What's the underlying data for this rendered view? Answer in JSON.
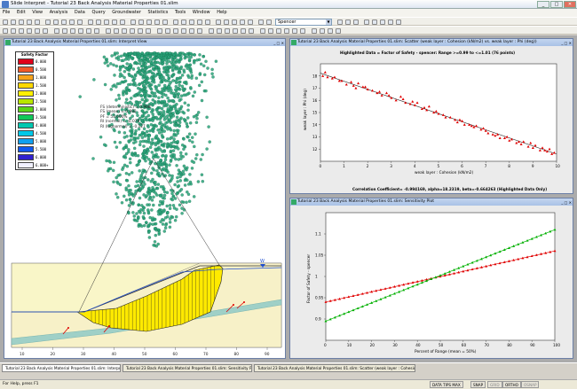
{
  "app_title": "Slide Interpret - Tutorial 23 Back Analysis Material Properties 01.slim",
  "window_controls": {
    "min": "_",
    "max": "□",
    "close": "✕"
  },
  "menu": [
    "File",
    "Edit",
    "View",
    "Analysis",
    "Data",
    "Query",
    "Groundwater",
    "Statistics",
    "Tools",
    "Window",
    "Help"
  ],
  "method_combo": "Spencer",
  "windows": {
    "interpret": {
      "title": "Tutorial 23 Back Analysis Material Properties 01.slim: Interpret View",
      "legend_title": "Safety Factor",
      "legend": [
        {
          "value": "0.000",
          "color": "#e0001a"
        },
        {
          "value": "0.500",
          "color": "#f05828"
        },
        {
          "value": "1.000",
          "color": "#f6a21a"
        },
        {
          "value": "1.500",
          "color": "#ffd800"
        },
        {
          "value": "2.000",
          "color": "#fff000"
        },
        {
          "value": "2.500",
          "color": "#b8e600"
        },
        {
          "value": "3.000",
          "color": "#5ad418"
        },
        {
          "value": "3.500",
          "color": "#10c85a"
        },
        {
          "value": "4.000",
          "color": "#00c8b0"
        },
        {
          "value": "4.500",
          "color": "#00c8e8"
        },
        {
          "value": "5.000",
          "color": "#10a0f0"
        },
        {
          "value": "5.500",
          "color": "#1058f0"
        },
        {
          "value": "6.000",
          "color": "#3020d0"
        },
        {
          "value": "6.000+",
          "color": "#f0f0ff"
        }
      ],
      "annotation": [
        "FS (deterministic) = 0.998",
        "FS (mean) = 0.992",
        "PF = 53.600%",
        "RI (normal) = -0.079",
        "RI (lognormal) = -0.127"
      ],
      "water_marker": "W",
      "x_ticks": [
        "10",
        "20",
        "30",
        "40",
        "50",
        "60",
        "70",
        "80",
        "90"
      ]
    },
    "scatter": {
      "title": "Tutorial 23 Back Analysis Material Properties 01.slim: Scatter (weak layer : Cohesion (kN/m2) vs. weak layer : Phi (deg))",
      "chart_title": "Highlighted Data = Factor of Safety - spencer: Range >=0.99 to <=1.01   (76 points)",
      "footer": "Correlation Coefficient= -0.994169, alpha=18.2319, beta=-0.664263 (Highlighted Data Only)",
      "xlabel": "weak layer : Cohesion (kN/m2)",
      "ylabel": "weak layer : Phi (deg)"
    },
    "sensitivity": {
      "title": "Tutorial 23 Back Analysis Material Properties 01.slim: Sensitivity Plot",
      "xlabel": "Percent of Range (mean = 50%)",
      "ylabel": "Factor of Safety - spencer"
    }
  },
  "chart_data": [
    {
      "type": "scatter",
      "title": "Highlighted Data = Factor of Safety - spencer: Range >=0.99 to <=1.01   (76 points)",
      "xlabel": "weak layer : Cohesion (kN/m2)",
      "ylabel": "weak layer : Phi (deg)",
      "xlim": [
        0,
        10
      ],
      "ylim": [
        11,
        19
      ],
      "x_ticks": [
        0,
        1,
        2,
        3,
        4,
        5,
        6,
        7,
        8,
        9,
        10
      ],
      "y_ticks": [
        12,
        13,
        14,
        15,
        16,
        17,
        18
      ],
      "fit_line": {
        "x": [
          0,
          10
        ],
        "y": [
          18.23,
          11.59
        ]
      },
      "points": [
        [
          0.1,
          18.0
        ],
        [
          0.3,
          17.9
        ],
        [
          0.5,
          17.8
        ],
        [
          0.2,
          18.3
        ],
        [
          0.9,
          17.6
        ],
        [
          1.1,
          17.3
        ],
        [
          1.3,
          17.5
        ],
        [
          1.5,
          17.0
        ],
        [
          1.6,
          17.4
        ],
        [
          1.8,
          17.1
        ],
        [
          2.0,
          16.9
        ],
        [
          2.2,
          16.8
        ],
        [
          2.4,
          16.6
        ],
        [
          2.6,
          16.4
        ],
        [
          2.8,
          16.6
        ],
        [
          3.0,
          16.2
        ],
        [
          3.2,
          16.0
        ],
        [
          3.4,
          16.3
        ],
        [
          3.6,
          15.8
        ],
        [
          3.8,
          15.7
        ],
        [
          4.0,
          15.6
        ],
        [
          4.1,
          15.8
        ],
        [
          4.3,
          15.3
        ],
        [
          4.5,
          15.2
        ],
        [
          4.6,
          15.5
        ],
        [
          4.8,
          15.0
        ],
        [
          5.0,
          14.9
        ],
        [
          5.2,
          14.8
        ],
        [
          5.3,
          14.6
        ],
        [
          5.5,
          14.6
        ],
        [
          5.7,
          14.4
        ],
        [
          5.8,
          14.2
        ],
        [
          6.0,
          14.3
        ],
        [
          6.1,
          14.0
        ],
        [
          6.3,
          14.0
        ],
        [
          6.5,
          13.8
        ],
        [
          6.6,
          13.9
        ],
        [
          6.8,
          13.6
        ],
        [
          7.0,
          13.5
        ],
        [
          7.1,
          13.3
        ],
        [
          7.3,
          13.2
        ],
        [
          7.5,
          13.2
        ],
        [
          7.6,
          12.9
        ],
        [
          7.8,
          12.9
        ],
        [
          8.0,
          12.7
        ],
        [
          8.1,
          12.8
        ],
        [
          8.3,
          12.5
        ],
        [
          8.5,
          12.4
        ],
        [
          8.6,
          12.6
        ],
        [
          8.8,
          12.2
        ],
        [
          9.0,
          12.1
        ],
        [
          9.1,
          12.3
        ],
        [
          9.3,
          11.9
        ],
        [
          9.5,
          11.9
        ],
        [
          9.6,
          11.8
        ],
        [
          9.8,
          11.6
        ],
        [
          9.9,
          11.7
        ],
        [
          9.7,
          12.0
        ],
        [
          9.4,
          12.1
        ],
        [
          8.9,
          12.5
        ],
        [
          7.9,
          13.0
        ],
        [
          6.9,
          13.7
        ],
        [
          5.9,
          14.4
        ],
        [
          4.9,
          15.1
        ],
        [
          3.9,
          15.9
        ],
        [
          2.9,
          16.4
        ],
        [
          1.9,
          17.1
        ],
        [
          0.8,
          17.6
        ],
        [
          0.6,
          17.9
        ],
        [
          1.4,
          17.2
        ],
        [
          2.5,
          16.7
        ],
        [
          3.5,
          16.1
        ],
        [
          4.4,
          15.4
        ],
        [
          6.4,
          13.9
        ],
        [
          7.4,
          13.1
        ],
        [
          8.4,
          12.6
        ]
      ]
    },
    {
      "type": "line",
      "xlabel": "Percent of Range (mean = 50%)",
      "ylabel": "Factor of Safety - spencer",
      "xlim": [
        0,
        100
      ],
      "ylim": [
        0.85,
        1.15
      ],
      "x_ticks": [
        0,
        10,
        20,
        30,
        40,
        50,
        60,
        70,
        80,
        90,
        100
      ],
      "y_ticks": [
        0.9,
        0.95,
        1.0,
        1.05,
        1.1
      ],
      "series": [
        {
          "color": "#e00000",
          "x": [
            0,
            100
          ],
          "y": [
            0.94,
            1.06
          ]
        },
        {
          "color": "#00b000",
          "x": [
            0,
            100
          ],
          "y": [
            0.895,
            1.11
          ]
        }
      ]
    }
  ],
  "taskbar": [
    "Tutorial 23 Back Analysis Material Properties 01.slim: Interpret View",
    "Tutorial 23 Back Analysis Material Properties 01.slim: Sensitivity Plot",
    "Tutorial 23 Back Analysis Material Properties 01.slim: Scatter (weak layer : Cohesion (kN/m2) vs. weak la"
  ],
  "status": {
    "help": "For Help, press F1",
    "buttons": [
      "DATA TIPS MAX",
      "SNAP",
      "GRID",
      "ORTHO",
      "OSNAP"
    ]
  }
}
